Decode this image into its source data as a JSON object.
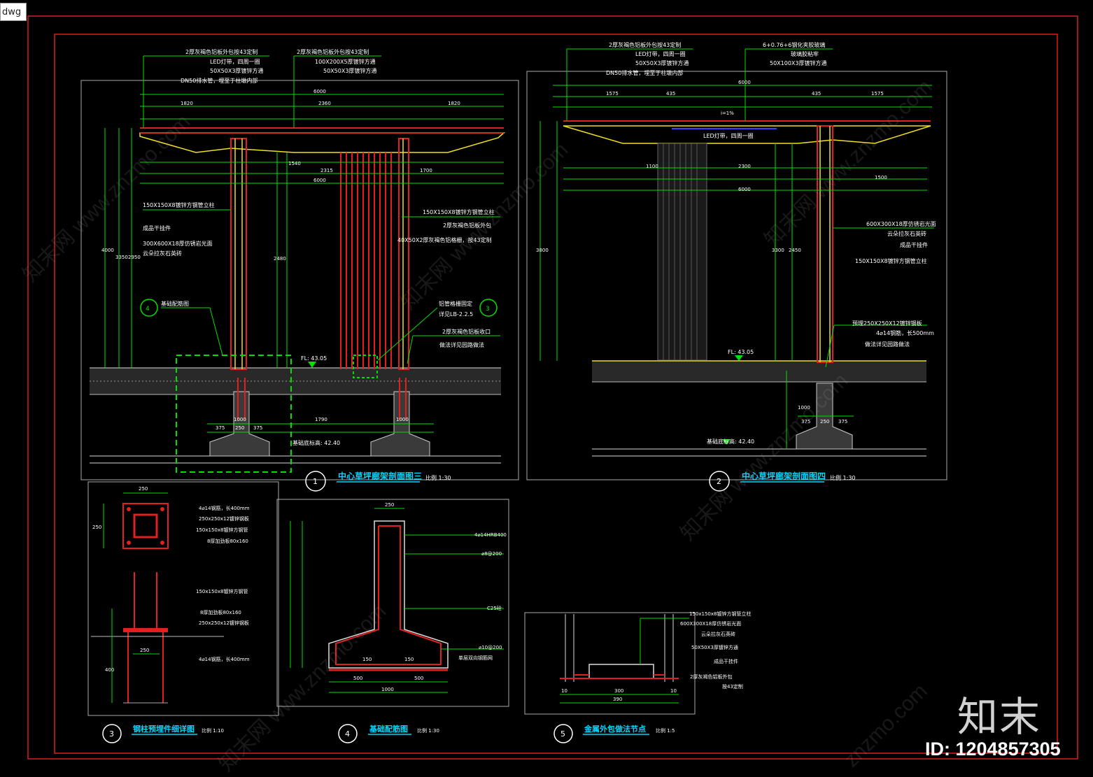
{
  "file_tab": "dwg",
  "brand_mark": "知末",
  "drawing_id": "ID: 1204857305",
  "watermarks": [
    "知末网 www.znzmo.com",
    "znzmo.com"
  ],
  "colors": {
    "frame": "#d81e1e",
    "dimension": "#00e000",
    "annotation": "#ffffff",
    "title": "#00d8ff",
    "structure_red": "#e02020",
    "structure_yellow": "#f0e020"
  },
  "views": [
    {
      "num": "1",
      "title": "中心草坪廊架剖面图三",
      "scale": "比例 1:30"
    },
    {
      "num": "2",
      "title": "中心草坪廊架剖面图四",
      "scale": "比例 1:30"
    },
    {
      "num": "3",
      "title": "钢柱预埋件细详图",
      "scale": "比例 1:10"
    },
    {
      "num": "4",
      "title": "基础配筋图",
      "scale": "比例 1:30"
    },
    {
      "num": "5",
      "title": "金属外包做法节点",
      "scale": "比例 1:5"
    }
  ],
  "elevation_labels": [
    "FL: 43.05",
    "FL: 43.05",
    "基础底标高: 42.40",
    "基础底标高: 42.40"
  ],
  "notes_view1_top": [
    "2厚灰褐色铝板外包按43定制",
    "LED灯带，四周一圈",
    "50X50X3厚镀锌方通",
    "DN50排水管，埋至于柱墩内部"
  ],
  "notes_view1_top2": [
    "2厚灰褐色铝板外包按43定制",
    "100X200X5厚镀锌方通",
    "50X50X3厚镀锌方通"
  ],
  "notes_view1_left": [
    "150X150X8镀锌方钢管立柱",
    "成品干挂件",
    "300X600X18厚仿锈岩光面",
    "云朵拉灰石英砖"
  ],
  "notes_view1_right": [
    "150X150X8镀锌方钢管立柱",
    "2厚灰褐色铝板外包",
    "40X50X2厚灰褐色铝格栅，按43定制"
  ],
  "notes_view1_mid": [
    "基础配筋图",
    "铝管格栅固定",
    "详见LB-2.2.5",
    "2厚灰褐色铝板收口",
    "做法详见园路做法"
  ],
  "notes_view2_top": [
    "2厚灰褐色铝板外包按43定制",
    "LED灯带，四周一圈",
    "50X50X3厚镀锌方通",
    "DN50排水管，埋至于柱墩内部"
  ],
  "notes_view2_top2": [
    "6+0.76+6钢化夹胶玻璃",
    "玻璃胶粘牢",
    "50X100X3厚镀锌方通"
  ],
  "notes_view2_mid": [
    "LED灯带，四周一圈"
  ],
  "notes_view2_right": [
    "600X300X18厚仿锈岩光面",
    "云朵拉灰石英砖",
    "成品干挂件",
    "150X150X8镀锌方钢管立柱"
  ],
  "notes_view2_right2": [
    "预埋250X250X12镀锌钢板",
    "4⌀14钢筋，长500mm",
    "做法详见园路做法"
  ],
  "notes_view3": [
    "4⌀14钢筋，长400mm",
    "250x250x12镀锌钢板",
    "150x150x8镀锌方钢管",
    "8厚加劲板80x160",
    "150x150x8镀锌方钢管",
    "8厚加劲板80x160",
    "250x250x12镀锌钢板",
    "4⌀14钢筋，长400mm"
  ],
  "notes_view4": [
    "4⌀14HRB400",
    "⌀8@200",
    "C25砼",
    "⌀10@200",
    "单层双向钢筋网"
  ],
  "notes_view5": [
    "150x150x8镀锌方钢管立柱",
    "600X300X18厚仿锈岩光面",
    "云朵拉灰石英砖",
    "50X50X3厚镀锌方通",
    "成品干挂件",
    "2厚灰褐色铝板外包",
    "按43定制"
  ],
  "dims_view1_top": [
    "6000",
    "1820",
    "2360",
    "1820"
  ],
  "dims_view1_bottom": [
    "6000",
    "1540",
    "2315",
    "1700"
  ],
  "dims_view1_heights": [
    "4000",
    "3350",
    "2950",
    "2480"
  ],
  "dims_view1_found": [
    "1000",
    "375",
    "250",
    "375",
    "1790",
    "1000"
  ],
  "dims_view2_top": [
    "6000",
    "1575",
    "435",
    "435",
    "1575"
  ],
  "dims_view2_bottom": [
    "6000",
    "1100",
    "2300",
    "1500"
  ],
  "dims_view2_heights": [
    "3800",
    "3300",
    "2450"
  ],
  "dims_view2_found": [
    "1000",
    "375",
    "250",
    "375"
  ],
  "dims_view3": [
    "250",
    "250",
    "250",
    "400"
  ],
  "dims_view4": [
    "250",
    "1000",
    "500",
    "500",
    "150",
    "150"
  ],
  "dims_view5": [
    "390",
    "10",
    "300",
    "10"
  ],
  "slope_label": "i=1%"
}
